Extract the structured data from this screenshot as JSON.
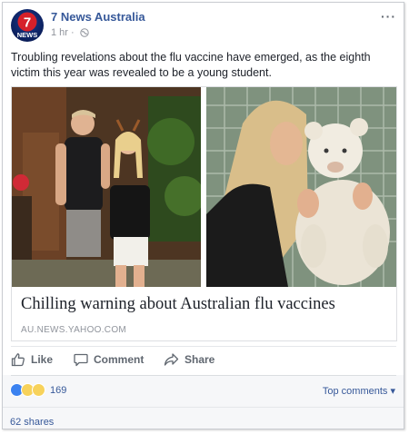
{
  "post": {
    "page_name": "7 News Australia",
    "time": "1 hr",
    "more_label": "···",
    "text": "Troubling revelations about the flu vaccine have emerged, as the eighth victim this year was revealed to be a young student.",
    "avatar_logo": "7",
    "avatar_sub": "NEWS"
  },
  "link": {
    "title": "Chilling warning about Australian flu vaccines",
    "domain": "AU.NEWS.YAHOO.COM"
  },
  "actions": {
    "like": "Like",
    "comment": "Comment",
    "share": "Share"
  },
  "footer": {
    "reaction_count": "169",
    "top_comments": "Top comments ▾",
    "shares": "62 shares"
  },
  "icons": {
    "globe": "globe-icon",
    "like": "thumbs-up-icon",
    "comment": "comment-bubble-icon",
    "share": "share-arrow-icon"
  },
  "colors": {
    "link_blue": "#365899",
    "brand_red": "#d6202a",
    "avatar_navy": "#0b1f5c",
    "like_blue": "#3b82f0"
  }
}
